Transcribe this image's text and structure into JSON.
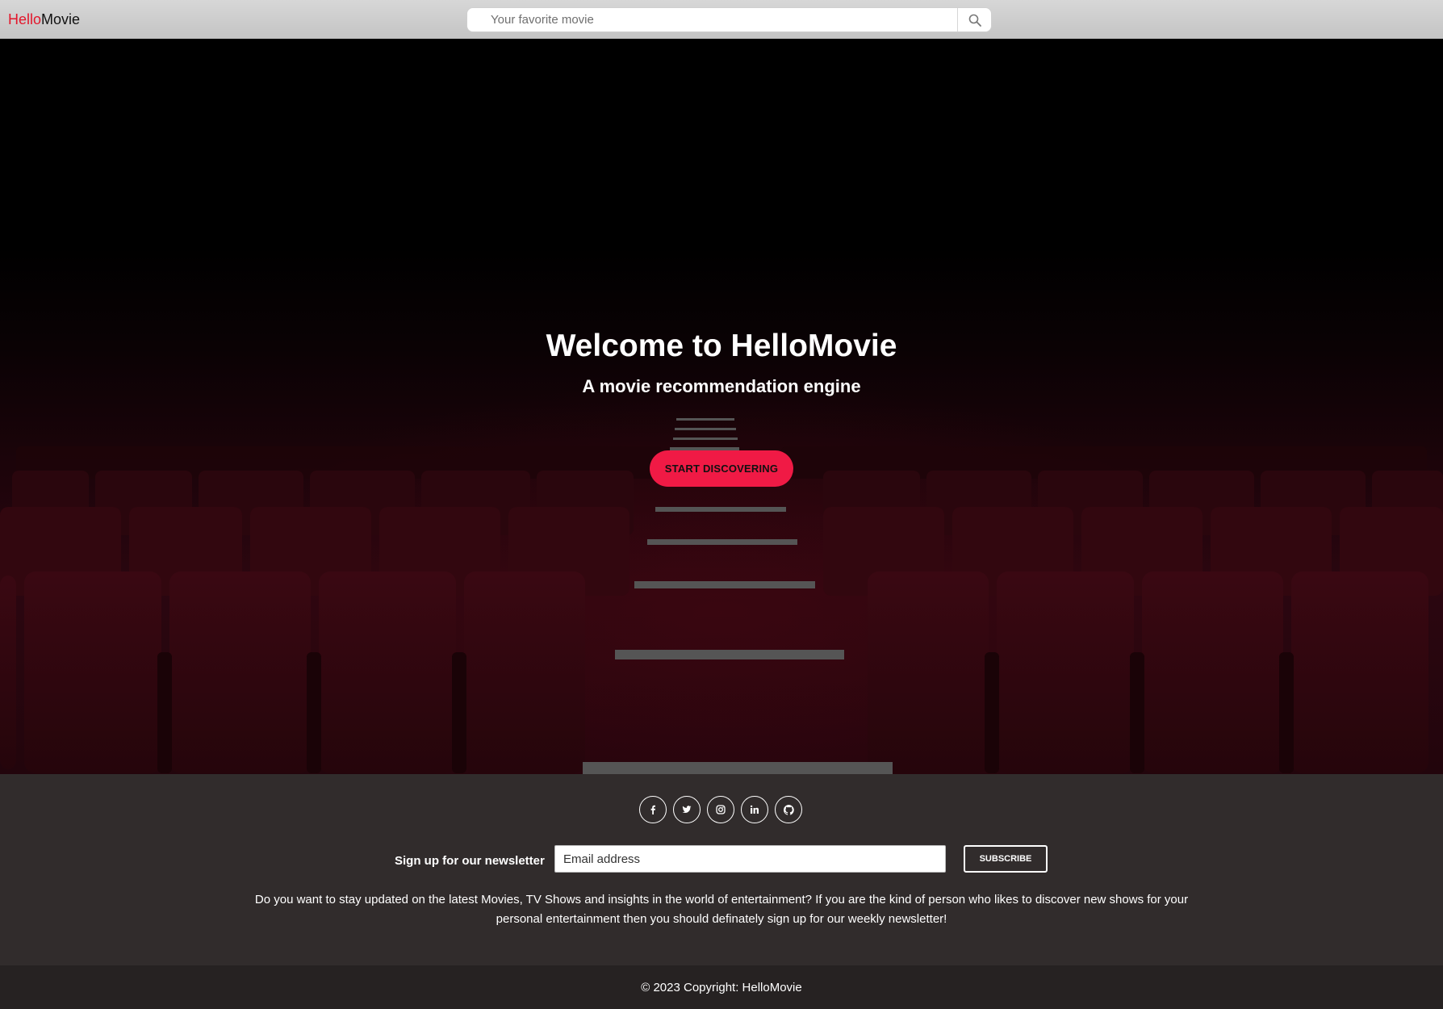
{
  "brand": {
    "part1": "Hello",
    "part2": "Movie",
    "accent_color": "#e3162b"
  },
  "search": {
    "placeholder": "Your favorite movie",
    "icon": "search-icon"
  },
  "hero": {
    "title": "Welcome to HelloMovie",
    "subtitle": "A movie recommendation engine",
    "cta_label": "START DISCOVERING",
    "cta_color": "#f01a45",
    "background": "dark cinema seats"
  },
  "footer": {
    "socials": [
      {
        "icon": "facebook-icon"
      },
      {
        "icon": "twitter-icon"
      },
      {
        "icon": "instagram-icon"
      },
      {
        "icon": "linkedin-icon"
      },
      {
        "icon": "github-icon"
      }
    ],
    "newsletter_label": "Sign up for our newsletter",
    "email_placeholder": "Email address",
    "subscribe_label": "SUBSCRIBE",
    "newsletter_text": "Do you want to stay updated on the latest Movies, TV Shows and insights in the world of entertainment? If you are the kind of person who likes to discover new shows for your personal entertainment then you should definately sign up for our weekly newsletter!",
    "copyright": "© 2023 Copyright: HelloMovie"
  }
}
